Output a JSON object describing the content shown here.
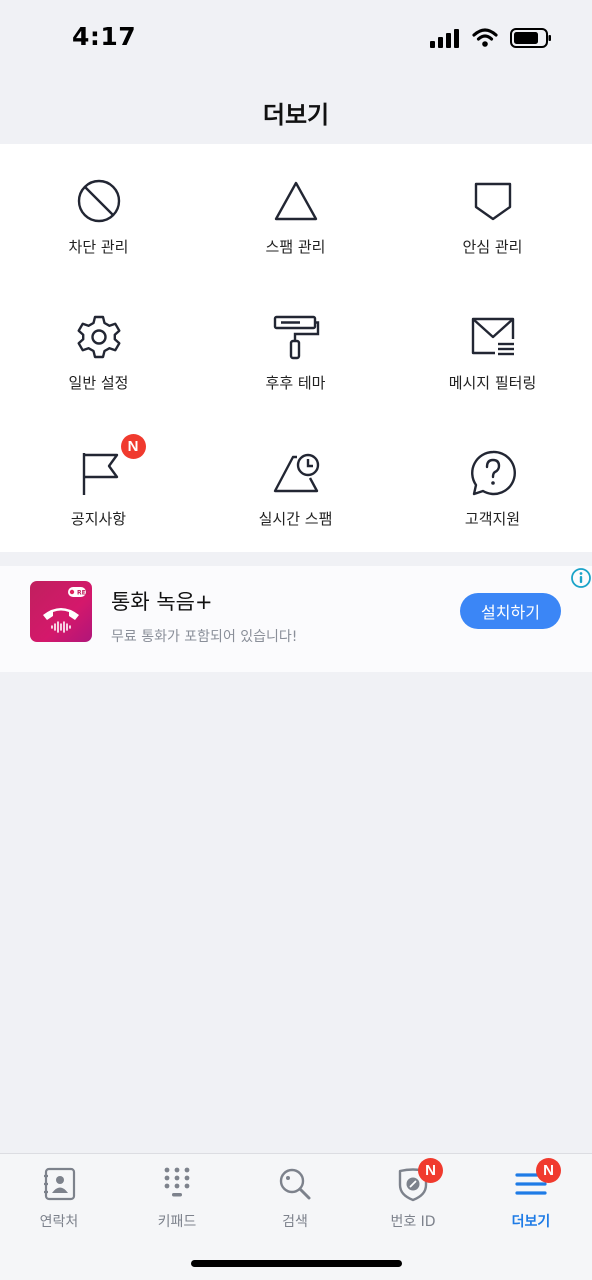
{
  "status_bar": {
    "time": "4:17"
  },
  "header": {
    "title": "더보기"
  },
  "menu": {
    "items": [
      {
        "label": "차단 관리",
        "icon": "block-icon"
      },
      {
        "label": "스팸 관리",
        "icon": "triangle-icon"
      },
      {
        "label": "안심 관리",
        "icon": "shield-icon"
      },
      {
        "label": "일반 설정",
        "icon": "gear-icon"
      },
      {
        "label": "후후 테마",
        "icon": "paint-roller-icon"
      },
      {
        "label": "메시지 필터링",
        "icon": "message-filter-icon"
      },
      {
        "label": "공지사항",
        "icon": "flag-icon",
        "badge": "N"
      },
      {
        "label": "실시간 스팸",
        "icon": "realtime-spam-icon"
      },
      {
        "label": "고객지원",
        "icon": "help-icon"
      }
    ]
  },
  "ad": {
    "app_icon": "call-recording-app-icon",
    "app_icon_text": "REC",
    "title": "통화 녹음+",
    "subtitle": "무료 통화가 포함되어 있습니다!",
    "install_label": "설치하기",
    "info_icon": "info-icon"
  },
  "tab_bar": {
    "items": [
      {
        "label": "연락처",
        "icon": "contacts-icon"
      },
      {
        "label": "키패드",
        "icon": "keypad-icon"
      },
      {
        "label": "검색",
        "icon": "search-icon"
      },
      {
        "label": "번호 ID",
        "icon": "number-id-icon",
        "badge": "N"
      },
      {
        "label": "더보기",
        "icon": "more-menu-icon",
        "badge": "N",
        "active": true
      }
    ]
  },
  "colors": {
    "accent": "#1e7be6",
    "badge": "#f03a2e",
    "install_button": "#3b86f6",
    "background": "#f0f1f5",
    "icon_stroke": "#222633"
  }
}
